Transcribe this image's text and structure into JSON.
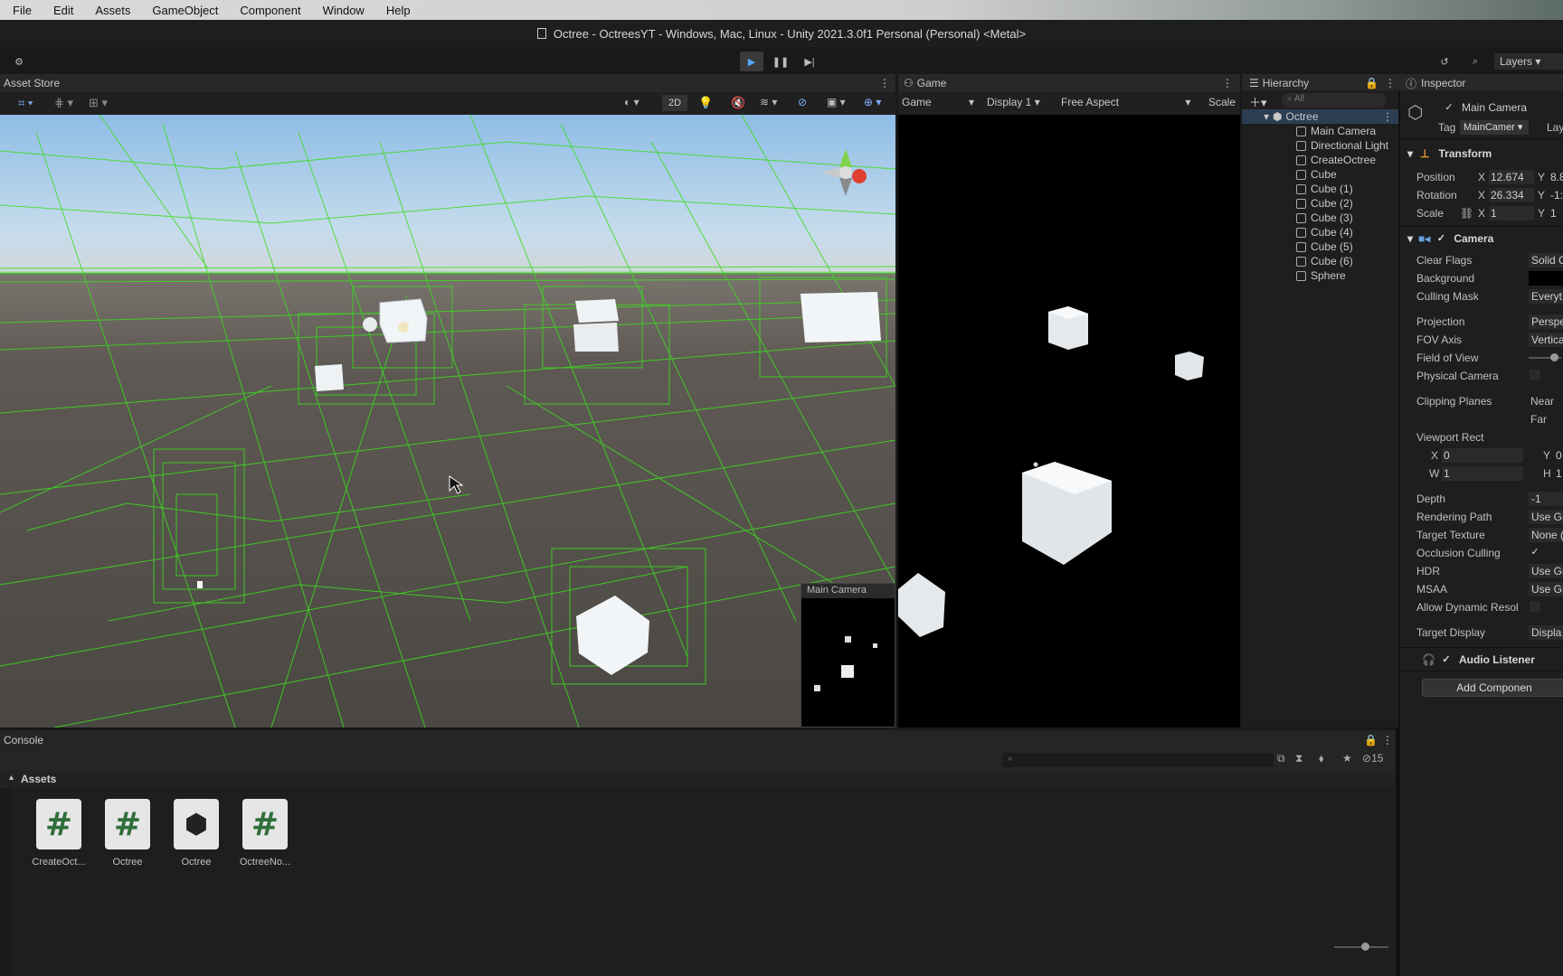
{
  "menu": [
    "File",
    "Edit",
    "Assets",
    "GameObject",
    "Component",
    "Window",
    "Help"
  ],
  "window_title": "Octree - OctreesYT - Windows, Mac, Linux - Unity 2021.3.0f1 Personal (Personal) <Metal>",
  "toolbar": {
    "layers_label": "Layers"
  },
  "scene": {
    "tab": "Asset Store",
    "mode_2d": "2D",
    "cam_preview_title": "Main Camera"
  },
  "game": {
    "tab": "Game",
    "dropdown_game": "Game",
    "display": "Display 1",
    "aspect": "Free Aspect",
    "scale": "Scale"
  },
  "hierarchy": {
    "tab": "Hierarchy",
    "search_placeholder": "All",
    "root": "Octree",
    "items": [
      "Main Camera",
      "Directional Light",
      "CreateOctree",
      "Cube",
      "Cube (1)",
      "Cube (2)",
      "Cube (3)",
      "Cube (4)",
      "Cube (5)",
      "Cube (6)",
      "Sphere"
    ]
  },
  "inspector": {
    "tab": "Inspector",
    "object_name": "Main Camera",
    "tag_label": "Tag",
    "tag_value": "MainCamer",
    "layer_label": "Lay",
    "transform": {
      "title": "Transform",
      "position_label": "Position",
      "pos_x": "12.674",
      "pos_y": "8.8",
      "rotation_label": "Rotation",
      "rot_x": "26.334",
      "rot_y": "-1:",
      "scale_label": "Scale",
      "scale_x": "1",
      "scale_y": "1"
    },
    "camera": {
      "title": "Camera",
      "rows": [
        {
          "label": "Clear Flags",
          "value": "Solid C"
        },
        {
          "label": "Background",
          "value": ""
        },
        {
          "label": "Culling Mask",
          "value": "Everyt"
        },
        {
          "label": "Projection",
          "value": "Perspe"
        },
        {
          "label": "FOV Axis",
          "value": "Vertica"
        },
        {
          "label": "Field of View",
          "value": ""
        },
        {
          "label": "Physical Camera",
          "value": ""
        },
        {
          "label": "Clipping Planes",
          "value": "Near"
        },
        {
          "label": "",
          "value": "Far"
        },
        {
          "label": "Viewport Rect",
          "value": ""
        },
        {
          "label": "Depth",
          "value": "-1"
        },
        {
          "label": "Rendering Path",
          "value": "Use Gr"
        },
        {
          "label": "Target Texture",
          "value": "None ("
        },
        {
          "label": "Occlusion Culling",
          "value": "✓"
        },
        {
          "label": "HDR",
          "value": "Use Gr"
        },
        {
          "label": "MSAA",
          "value": "Use Gr"
        },
        {
          "label": "Allow Dynamic Resol",
          "value": ""
        },
        {
          "label": "Target Display",
          "value": "Displa"
        }
      ],
      "vr_x_label": "X",
      "vr_x": "0",
      "vr_y_label": "Y",
      "vr_y": "0",
      "vr_w_label": "W",
      "vr_w": "1",
      "vr_h_label": "H",
      "vr_h": "1"
    },
    "audio_listener": "Audio Listener",
    "add_component": "Add Componen"
  },
  "console": {
    "tab": "Console",
    "count": "15"
  },
  "assets": {
    "title": "Assets",
    "items": [
      {
        "name": "CreateOct...",
        "icon": "script-icon"
      },
      {
        "name": "Octree",
        "icon": "script-icon"
      },
      {
        "name": "Octree",
        "icon": "unity-scene-icon"
      },
      {
        "name": "OctreeNo...",
        "icon": "script-icon"
      }
    ]
  },
  "colors": {
    "octree_lines": "#37e61c",
    "play_accent": "#5aa4ff"
  }
}
